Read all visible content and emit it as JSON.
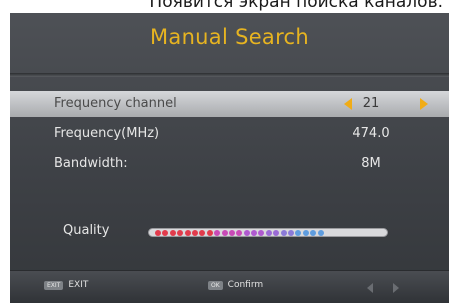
{
  "caption": "Появится экран поиска каналов.",
  "screen": {
    "title": "Manual Search",
    "rows": [
      {
        "label": "Frequency channel",
        "value": "21"
      },
      {
        "label": "Frequency(MHz)",
        "value": "474.0"
      },
      {
        "label": "Bandwidth:",
        "value": "8M"
      }
    ],
    "quality": {
      "label": "Quality",
      "segments": 23,
      "level": 1.0,
      "colors": [
        "#e23b4c",
        "#e23b4c",
        "#e23b4c",
        "#e23b4c",
        "#e23b4c",
        "#e23b4c",
        "#e23b4c",
        "#e23b4c",
        "#c94ab7",
        "#c94ab7",
        "#c94ab7",
        "#c94ab7",
        "#b05ad0",
        "#b05ad0",
        "#b05ad0",
        "#9b6bd6",
        "#9b6bd6",
        "#8b7ad8",
        "#8b7ad8",
        "#5f9ddf",
        "#5f9ddf",
        "#5f9ddf",
        "#5f9ddf"
      ]
    },
    "footer": {
      "exit_key": "EXIT",
      "exit_label": "EXIT",
      "ok_key": "OK",
      "ok_label": "Confirm"
    }
  }
}
